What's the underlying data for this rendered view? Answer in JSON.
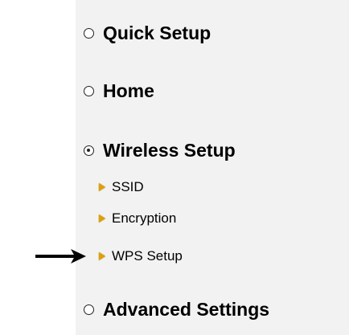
{
  "menu": {
    "items": [
      {
        "label": "Quick Setup",
        "selected": false
      },
      {
        "label": "Home",
        "selected": false
      },
      {
        "label": "Wireless Setup",
        "selected": true
      },
      {
        "label": "Advanced Settings",
        "selected": false
      }
    ],
    "wireless_submenu": [
      {
        "label": "SSID"
      },
      {
        "label": "Encryption"
      },
      {
        "label": "WPS Setup"
      }
    ]
  },
  "colors": {
    "panel_bg": "#f2f2f2",
    "submenu_triangle": "#e0a000"
  },
  "annotation": {
    "icon": "arrow-right-icon",
    "points_to": "WPS Setup"
  }
}
